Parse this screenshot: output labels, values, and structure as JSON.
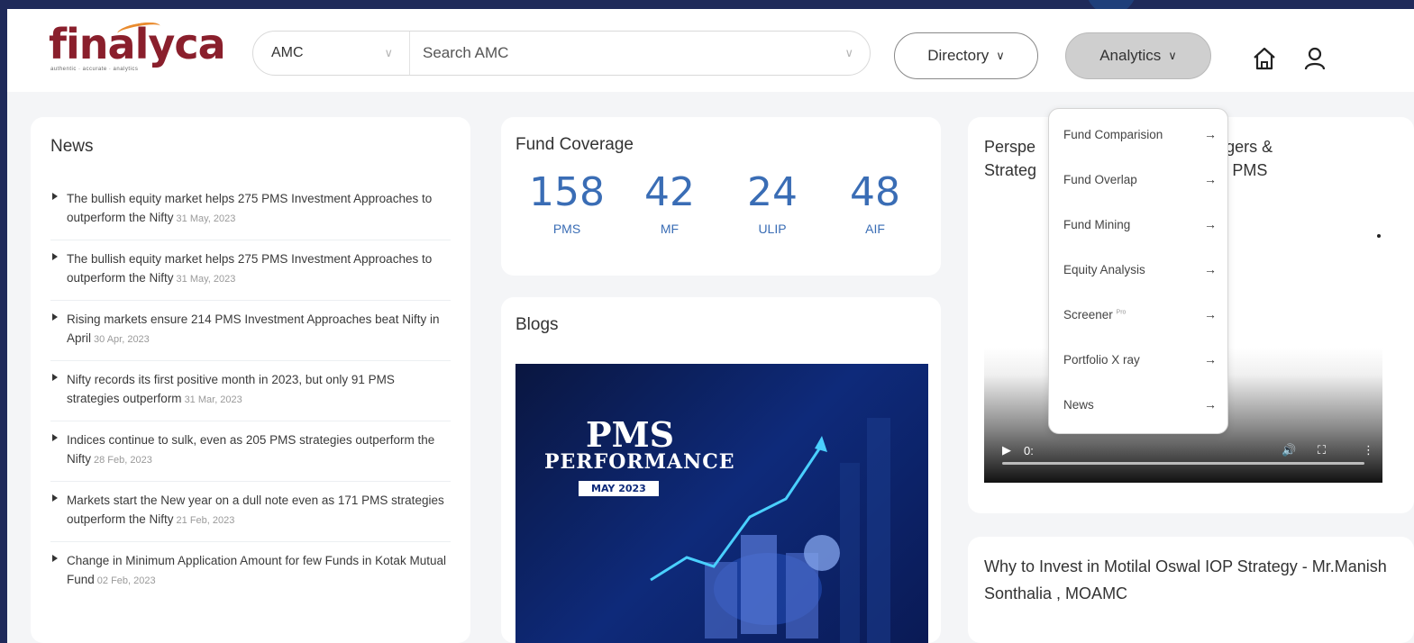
{
  "header": {
    "logo_text": "finalyca",
    "logo_tagline": "authentic · accurate · analytics",
    "amc_select": "AMC",
    "search_placeholder": "Search AMC",
    "directory_label": "Directory",
    "analytics_label": "Analytics"
  },
  "news": {
    "title": "News",
    "items": [
      {
        "text": "The bullish equity market helps 275 PMS Investment Approaches to outperform the Nifty",
        "date": "31 May, 2023"
      },
      {
        "text": "The bullish equity market helps 275 PMS Investment Approaches to outperform the Nifty",
        "date": "31 May, 2023"
      },
      {
        "text": "Rising markets ensure 214 PMS Investment Approaches beat Nifty in April",
        "date": "30 Apr, 2023"
      },
      {
        "text": "Nifty records its first positive month in 2023, but only 91 PMS strategies outperform",
        "date": "31 Mar, 2023"
      },
      {
        "text": "Indices continue to sulk, even as 205 PMS strategies outperform the Nifty",
        "date": "28 Feb, 2023"
      },
      {
        "text": "Markets start the New year on a dull note even as 171 PMS strategies outperform the Nifty",
        "date": "21 Feb, 2023"
      },
      {
        "text": "Change in Minimum Application Amount for few Funds in Kotak Mutual Fund",
        "date": "02 Feb, 2023"
      }
    ]
  },
  "coverage": {
    "title": "Fund Coverage",
    "stats": [
      {
        "value": "158",
        "label": "PMS"
      },
      {
        "value": "42",
        "label": "MF"
      },
      {
        "value": "24",
        "label": "ULIP"
      },
      {
        "value": "48",
        "label": "AIF"
      }
    ]
  },
  "blogs": {
    "title": "Blogs",
    "image_line1": "PMS",
    "image_line2": "PERFORMANCE",
    "image_badge": "MAY 2023"
  },
  "video": {
    "title_left1": "Perspe",
    "title_left2": "Strateg",
    "title_right1": "Managers &",
    "title_right2": "IIFL PMS",
    "time": "0:"
  },
  "invest": {
    "title": "Why to Invest in Motilal Oswal IOP Strategy - Mr.Manish Sonthalia , MOAMC"
  },
  "analytics_menu": {
    "items": [
      {
        "label": "Fund Comparision"
      },
      {
        "label": "Fund Overlap"
      },
      {
        "label": "Fund Mining"
      },
      {
        "label": "Equity Analysis"
      },
      {
        "label": "Screener",
        "badge": "Pro"
      },
      {
        "label": "Portfolio X ray"
      },
      {
        "label": "News"
      }
    ]
  }
}
